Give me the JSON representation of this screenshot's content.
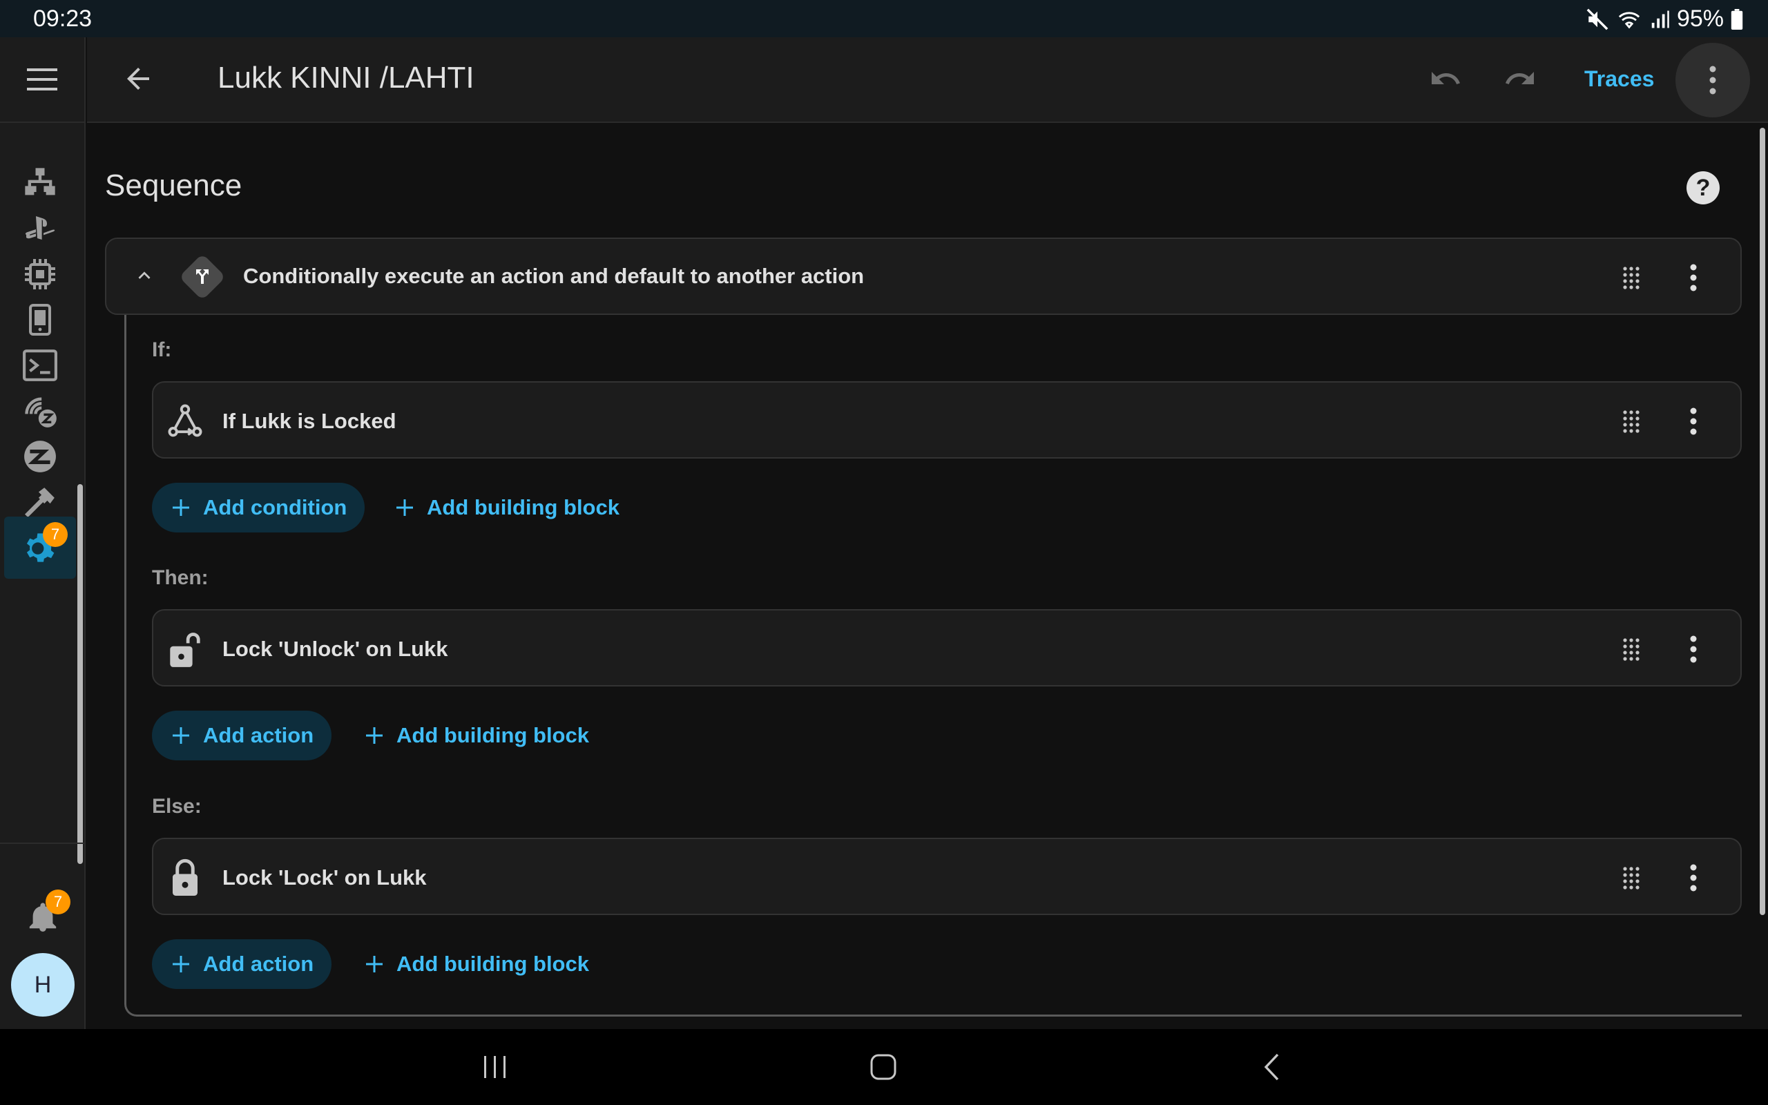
{
  "status_bar": {
    "time": "09:23",
    "battery": "95%"
  },
  "app_bar": {
    "title": "Lukk KINNI /LAHTI",
    "traces_label": "Traces"
  },
  "sidebar": {
    "items": [
      "sitemap-icon",
      "playstation-icon",
      "chip-icon",
      "tablet-icon",
      "terminal-icon",
      "zwave-icon",
      "zigbee-icon",
      "hammer-icon",
      "settings-icon"
    ],
    "settings_badge": "7",
    "notifications_badge": "7",
    "avatar_initial": "H"
  },
  "main": {
    "section_title": "Sequence",
    "choose_block": {
      "label": "Conditionally execute an action and default to another action"
    },
    "if": {
      "label": "If:",
      "condition": "If Lukk is Locked",
      "add_condition": "Add condition",
      "add_building_block": "Add building block"
    },
    "then": {
      "label": "Then:",
      "action": "Lock 'Unlock' on Lukk",
      "add_action": "Add action",
      "add_building_block": "Add building block"
    },
    "else": {
      "label": "Else:",
      "action": "Lock 'Lock' on Lukk",
      "add_action": "Add action",
      "add_building_block": "Add building block"
    }
  },
  "colors": {
    "accent": "#41bdf5",
    "badge": "#ff9800",
    "background": "#111111",
    "card": "#1c1c1c"
  }
}
